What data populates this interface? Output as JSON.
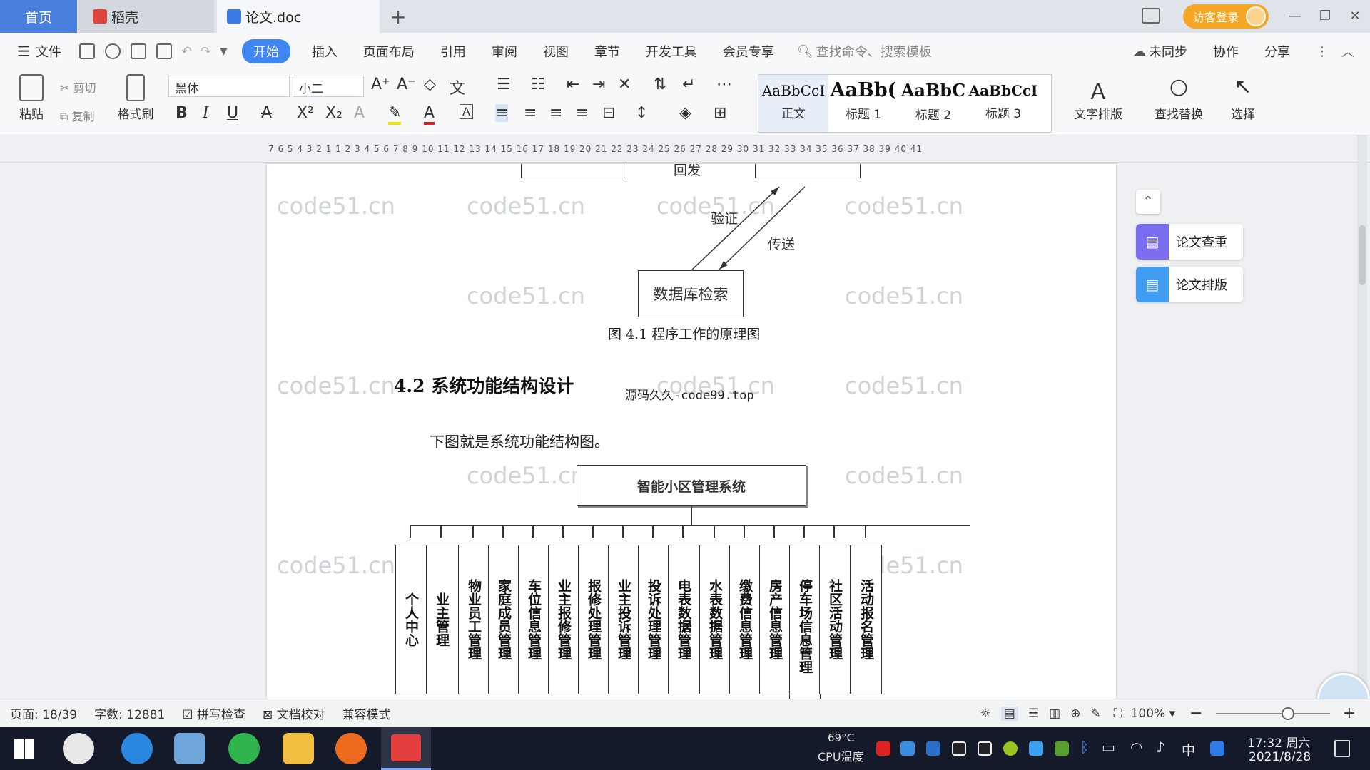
{
  "titlebar": {
    "tab_home": "首页",
    "tab_daoke": "稻壳",
    "tab_doc": "论文.doc",
    "visitor": "访客登录"
  },
  "menu": {
    "file": "文件",
    "items": [
      "开始",
      "插入",
      "页面布局",
      "引用",
      "审阅",
      "视图",
      "章节",
      "开发工具",
      "会员专享"
    ],
    "search_placeholder": "查找命令、搜索模板",
    "unsynced": "未同步",
    "collab": "协作",
    "share": "分享"
  },
  "ribbon": {
    "paste": "粘贴",
    "cut": "剪切",
    "copy": "复制",
    "format_painter": "格式刷",
    "font": "黑体",
    "size": "小二",
    "styles": [
      {
        "sample": "AaBbCcI",
        "label": "正文"
      },
      {
        "sample": "AaBb(",
        "label": "标题 1"
      },
      {
        "sample": "AaBbC",
        "label": "标题 2"
      },
      {
        "sample": "AaBbCcI",
        "label": "标题 3"
      }
    ],
    "text_layout": "文字排版",
    "find_replace": "查找替换",
    "select": "选择"
  },
  "ruler": {
    "ticks": "7 6 5 4 3 2 1   1 2 3 4 5 6 7 8 9 10 11 12 13 14 15 16 17 18 19 20 21 22 23 24 25 26 27 28 29 30 31 32 33 34 35 36 37 38 39 40 41"
  },
  "document": {
    "label_back": "回发",
    "label_verify": "验证",
    "label_send": "传送",
    "db_box": "数据库检索",
    "fig_caption": "图 4.1  程序工作的原理图",
    "heading": "4.2 系统功能结构设计",
    "source_note": "源码久久-code99.top",
    "para": "下图就是系统功能结构图。",
    "root_box": "智能小区管理系统",
    "modules": [
      "个人中心",
      "业主管理",
      "物业员工管理",
      "家庭成员管理",
      "车位信息管理",
      "业主报修管理",
      "报修处理管理",
      "业主投诉管理",
      "投诉处理管理",
      "电表数据管理",
      "水表数据管理",
      "缴费信息管理",
      "房产信息管理",
      "停车场信息管理",
      "社区活动管理",
      "活动报名管理"
    ],
    "watermark": "code51.cn"
  },
  "side": {
    "check": "论文查重",
    "format": "论文排版"
  },
  "status": {
    "page": "页面: 18/39",
    "words": "字数: 12881",
    "spell": "拼写检查",
    "proof": "文档校对",
    "compat": "兼容模式",
    "zoom": "100%"
  },
  "taskbar": {
    "temp": "69°C",
    "cpu": "CPU温度",
    "ime": "中",
    "time": "17:32 周六",
    "date": "2021/8/28"
  }
}
